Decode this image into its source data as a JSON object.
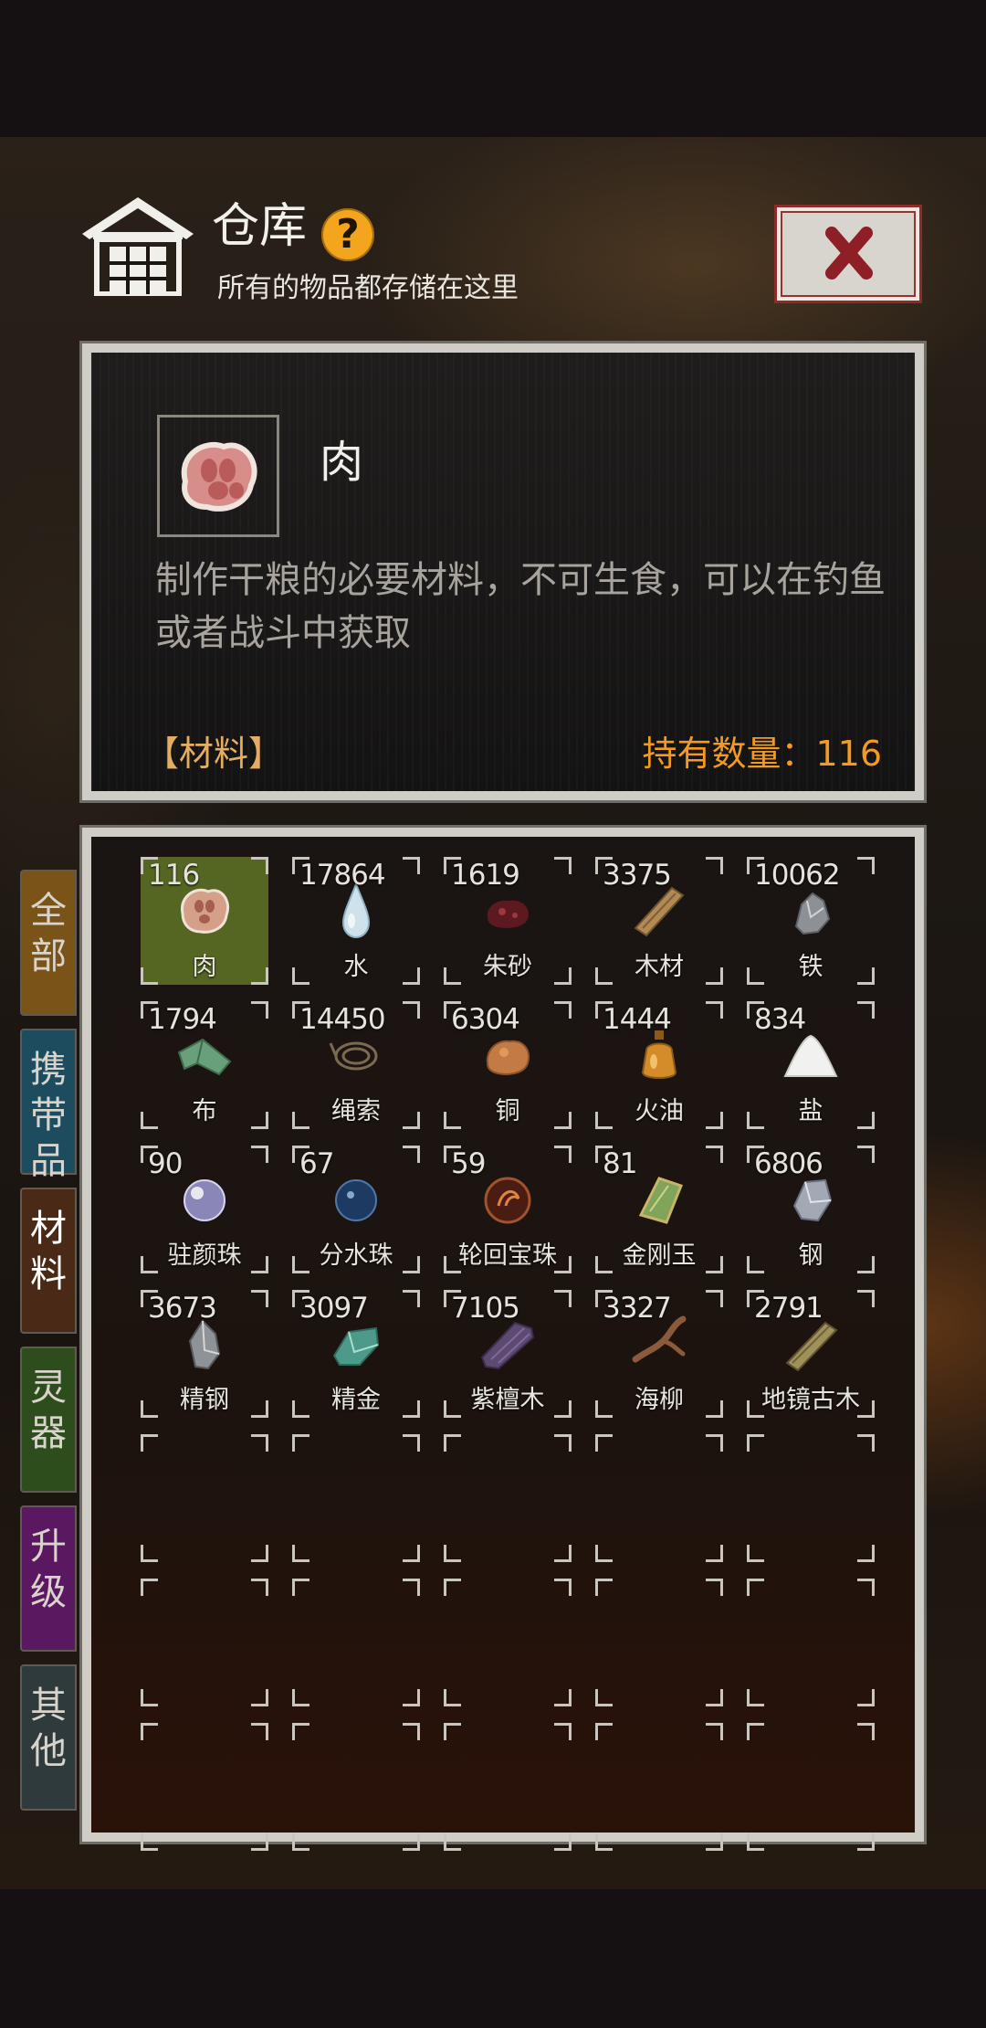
{
  "header": {
    "title": "仓库",
    "help_symbol": "?",
    "subtitle": "所有的物品都存储在这里"
  },
  "detail": {
    "name": "肉",
    "icon": "meat-icon",
    "description": "制作干粮的必要材料，不可生食，可以在钓鱼或者战斗中获取",
    "category": "【材料】",
    "count_text": "持有数量：116"
  },
  "tabs": [
    {
      "label": "全部",
      "color": "#7a5318"
    },
    {
      "label": "携带品",
      "color": "#1d4c5f"
    },
    {
      "label": "材料",
      "color": "#4a2a16",
      "active": true
    },
    {
      "label": "灵器",
      "color": "#2e4d1c"
    },
    {
      "label": "升级",
      "color": "#5a1860"
    },
    {
      "label": "其他",
      "color": "#2f3a3d"
    }
  ],
  "items": [
    {
      "qty": "116",
      "name": "肉",
      "icon": "meat-icon",
      "selected": true
    },
    {
      "qty": "17864",
      "name": "水",
      "icon": "water-drop-icon"
    },
    {
      "qty": "1619",
      "name": "朱砂",
      "icon": "cinnabar-icon"
    },
    {
      "qty": "3375",
      "name": "木材",
      "icon": "wood-plank-icon"
    },
    {
      "qty": "10062",
      "name": "铁",
      "icon": "iron-ore-icon"
    },
    {
      "qty": "1794",
      "name": "布",
      "icon": "cloth-icon"
    },
    {
      "qty": "14450",
      "name": "绳索",
      "icon": "rope-icon"
    },
    {
      "qty": "6304",
      "name": "铜",
      "icon": "copper-ore-icon"
    },
    {
      "qty": "1444",
      "name": "火油",
      "icon": "oil-bottle-icon"
    },
    {
      "qty": "834",
      "name": "盐",
      "icon": "salt-pile-icon"
    },
    {
      "qty": "90",
      "name": "驻颜珠",
      "icon": "pearl-icon"
    },
    {
      "qty": "67",
      "name": "分水珠",
      "icon": "water-pearl-icon"
    },
    {
      "qty": "59",
      "name": "轮回宝珠",
      "icon": "samsara-orb-icon"
    },
    {
      "qty": "81",
      "name": "金刚玉",
      "icon": "jade-icon"
    },
    {
      "qty": "6806",
      "name": "钢",
      "icon": "steel-icon"
    },
    {
      "qty": "3673",
      "name": "精钢",
      "icon": "refined-steel-icon"
    },
    {
      "qty": "3097",
      "name": "精金",
      "icon": "refined-gold-icon"
    },
    {
      "qty": "7105",
      "name": "紫檀木",
      "icon": "sandalwood-icon"
    },
    {
      "qty": "3327",
      "name": "海柳",
      "icon": "sea-willow-icon"
    },
    {
      "qty": "2791",
      "name": "地镜古木",
      "icon": "ancient-wood-icon"
    }
  ]
}
